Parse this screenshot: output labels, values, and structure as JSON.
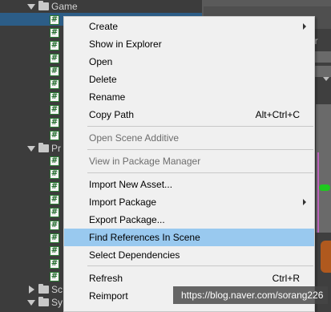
{
  "project_tree": {
    "game_folder": "Game",
    "pr_folder": "Pr",
    "sc_folder": "Sc",
    "sy_folder": "Sy",
    "script_glyph": "#"
  },
  "context_menu": {
    "items": [
      {
        "label": "Create",
        "shortcut": "",
        "submenu": true,
        "enabled": true,
        "highlighted": false
      },
      {
        "label": "Show in Explorer",
        "shortcut": "",
        "submenu": false,
        "enabled": true,
        "highlighted": false
      },
      {
        "label": "Open",
        "shortcut": "",
        "submenu": false,
        "enabled": true,
        "highlighted": false
      },
      {
        "label": "Delete",
        "shortcut": "",
        "submenu": false,
        "enabled": true,
        "highlighted": false
      },
      {
        "label": "Rename",
        "shortcut": "",
        "submenu": false,
        "enabled": true,
        "highlighted": false
      },
      {
        "label": "Copy Path",
        "shortcut": "Alt+Ctrl+C",
        "submenu": false,
        "enabled": true,
        "highlighted": false
      },
      {
        "label": "Open Scene Additive",
        "shortcut": "",
        "submenu": false,
        "enabled": false,
        "highlighted": false
      },
      {
        "label": "View in Package Manager",
        "shortcut": "",
        "submenu": false,
        "enabled": false,
        "highlighted": false
      },
      {
        "label": "Import New Asset...",
        "shortcut": "",
        "submenu": false,
        "enabled": true,
        "highlighted": false
      },
      {
        "label": "Import Package",
        "shortcut": "",
        "submenu": true,
        "enabled": true,
        "highlighted": false
      },
      {
        "label": "Export Package...",
        "shortcut": "",
        "submenu": false,
        "enabled": true,
        "highlighted": false
      },
      {
        "label": "Find References In Scene",
        "shortcut": "",
        "submenu": false,
        "enabled": true,
        "highlighted": true
      },
      {
        "label": "Select Dependencies",
        "shortcut": "",
        "submenu": false,
        "enabled": true,
        "highlighted": false
      },
      {
        "label": "Refresh",
        "shortcut": "Ctrl+R",
        "submenu": false,
        "enabled": true,
        "highlighted": false
      },
      {
        "label": "Reimport",
        "shortcut": "",
        "submenu": false,
        "enabled": true,
        "highlighted": false
      }
    ]
  },
  "inspector": {
    "partial_text": "or"
  },
  "watermark": {
    "text": "https://blog.naver.com/sorang226"
  },
  "colors": {
    "menu_highlight": "#99c9ef",
    "tree_selection": "#2c5d87",
    "script_icon_green": "#2a7a33"
  }
}
